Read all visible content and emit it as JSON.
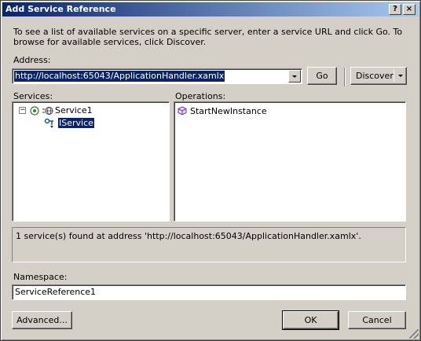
{
  "window": {
    "title": "Add Service Reference",
    "help_label": "?",
    "close_label": "×"
  },
  "intro": "To see a list of available services on a specific server, enter a service URL and click Go. To browse for available services, click Discover.",
  "address": {
    "label": "Address:",
    "value": "http://localhost:65043/ApplicationHandler.xamlx",
    "go_label": "Go",
    "discover_label": "Discover"
  },
  "services": {
    "label": "Services:",
    "items": [
      {
        "label": "Service1",
        "expanded": true
      },
      {
        "label": "IService",
        "selected": true
      }
    ]
  },
  "operations": {
    "label": "Operations:",
    "items": [
      {
        "label": "StartNewInstance"
      }
    ]
  },
  "status": "1 service(s) found at address 'http://localhost:65043/ApplicationHandler.xamlx'.",
  "namespace": {
    "label": "Namespace:",
    "value": "ServiceReference1"
  },
  "buttons": {
    "advanced": "Advanced...",
    "ok": "OK",
    "cancel": "Cancel"
  },
  "icons": {
    "expander": "minus-box-icon",
    "service": "globe-service-icon",
    "contract": "interface-contract-icon",
    "operation": "method-cube-icon"
  },
  "colors": {
    "titlebar_start": "#0a246a",
    "titlebar_end": "#a6caf0",
    "dialog_face": "#d4d0c8",
    "selection": "#0a246a"
  }
}
